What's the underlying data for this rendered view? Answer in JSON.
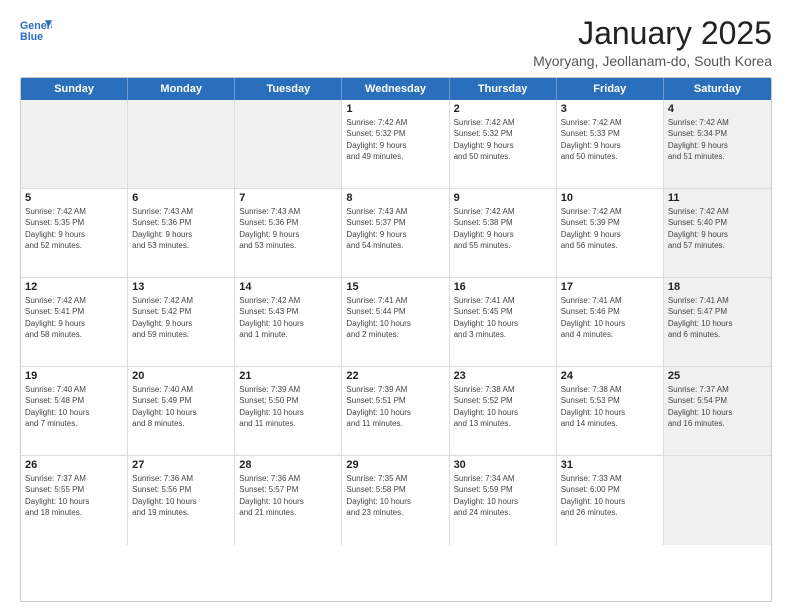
{
  "logo": {
    "line1": "General",
    "line2": "Blue"
  },
  "title": "January 2025",
  "location": "Myoryang, Jeollanam-do, South Korea",
  "header_days": [
    "Sunday",
    "Monday",
    "Tuesday",
    "Wednesday",
    "Thursday",
    "Friday",
    "Saturday"
  ],
  "weeks": [
    [
      {
        "day": "",
        "text": "",
        "shaded": true
      },
      {
        "day": "",
        "text": "",
        "shaded": true
      },
      {
        "day": "",
        "text": "",
        "shaded": true
      },
      {
        "day": "1",
        "text": "Sunrise: 7:42 AM\nSunset: 5:32 PM\nDaylight: 9 hours\nand 49 minutes."
      },
      {
        "day": "2",
        "text": "Sunrise: 7:42 AM\nSunset: 5:32 PM\nDaylight: 9 hours\nand 50 minutes."
      },
      {
        "day": "3",
        "text": "Sunrise: 7:42 AM\nSunset: 5:33 PM\nDaylight: 9 hours\nand 50 minutes."
      },
      {
        "day": "4",
        "text": "Sunrise: 7:42 AM\nSunset: 5:34 PM\nDaylight: 9 hours\nand 51 minutes.",
        "shaded": true
      }
    ],
    [
      {
        "day": "5",
        "text": "Sunrise: 7:42 AM\nSunset: 5:35 PM\nDaylight: 9 hours\nand 52 minutes."
      },
      {
        "day": "6",
        "text": "Sunrise: 7:43 AM\nSunset: 5:36 PM\nDaylight: 9 hours\nand 53 minutes."
      },
      {
        "day": "7",
        "text": "Sunrise: 7:43 AM\nSunset: 5:36 PM\nDaylight: 9 hours\nand 53 minutes."
      },
      {
        "day": "8",
        "text": "Sunrise: 7:43 AM\nSunset: 5:37 PM\nDaylight: 9 hours\nand 54 minutes."
      },
      {
        "day": "9",
        "text": "Sunrise: 7:42 AM\nSunset: 5:38 PM\nDaylight: 9 hours\nand 55 minutes."
      },
      {
        "day": "10",
        "text": "Sunrise: 7:42 AM\nSunset: 5:39 PM\nDaylight: 9 hours\nand 56 minutes."
      },
      {
        "day": "11",
        "text": "Sunrise: 7:42 AM\nSunset: 5:40 PM\nDaylight: 9 hours\nand 57 minutes.",
        "shaded": true
      }
    ],
    [
      {
        "day": "12",
        "text": "Sunrise: 7:42 AM\nSunset: 5:41 PM\nDaylight: 9 hours\nand 58 minutes."
      },
      {
        "day": "13",
        "text": "Sunrise: 7:42 AM\nSunset: 5:42 PM\nDaylight: 9 hours\nand 59 minutes."
      },
      {
        "day": "14",
        "text": "Sunrise: 7:42 AM\nSunset: 5:43 PM\nDaylight: 10 hours\nand 1 minute."
      },
      {
        "day": "15",
        "text": "Sunrise: 7:41 AM\nSunset: 5:44 PM\nDaylight: 10 hours\nand 2 minutes."
      },
      {
        "day": "16",
        "text": "Sunrise: 7:41 AM\nSunset: 5:45 PM\nDaylight: 10 hours\nand 3 minutes."
      },
      {
        "day": "17",
        "text": "Sunrise: 7:41 AM\nSunset: 5:46 PM\nDaylight: 10 hours\nand 4 minutes."
      },
      {
        "day": "18",
        "text": "Sunrise: 7:41 AM\nSunset: 5:47 PM\nDaylight: 10 hours\nand 6 minutes.",
        "shaded": true
      }
    ],
    [
      {
        "day": "19",
        "text": "Sunrise: 7:40 AM\nSunset: 5:48 PM\nDaylight: 10 hours\nand 7 minutes."
      },
      {
        "day": "20",
        "text": "Sunrise: 7:40 AM\nSunset: 5:49 PM\nDaylight: 10 hours\nand 8 minutes."
      },
      {
        "day": "21",
        "text": "Sunrise: 7:39 AM\nSunset: 5:50 PM\nDaylight: 10 hours\nand 11 minutes."
      },
      {
        "day": "22",
        "text": "Sunrise: 7:39 AM\nSunset: 5:51 PM\nDaylight: 10 hours\nand 11 minutes."
      },
      {
        "day": "23",
        "text": "Sunrise: 7:38 AM\nSunset: 5:52 PM\nDaylight: 10 hours\nand 13 minutes."
      },
      {
        "day": "24",
        "text": "Sunrise: 7:38 AM\nSunset: 5:53 PM\nDaylight: 10 hours\nand 14 minutes."
      },
      {
        "day": "25",
        "text": "Sunrise: 7:37 AM\nSunset: 5:54 PM\nDaylight: 10 hours\nand 16 minutes.",
        "shaded": true
      }
    ],
    [
      {
        "day": "26",
        "text": "Sunrise: 7:37 AM\nSunset: 5:55 PM\nDaylight: 10 hours\nand 18 minutes."
      },
      {
        "day": "27",
        "text": "Sunrise: 7:36 AM\nSunset: 5:56 PM\nDaylight: 10 hours\nand 19 minutes."
      },
      {
        "day": "28",
        "text": "Sunrise: 7:36 AM\nSunset: 5:57 PM\nDaylight: 10 hours\nand 21 minutes."
      },
      {
        "day": "29",
        "text": "Sunrise: 7:35 AM\nSunset: 5:58 PM\nDaylight: 10 hours\nand 23 minutes."
      },
      {
        "day": "30",
        "text": "Sunrise: 7:34 AM\nSunset: 5:59 PM\nDaylight: 10 hours\nand 24 minutes."
      },
      {
        "day": "31",
        "text": "Sunrise: 7:33 AM\nSunset: 6:00 PM\nDaylight: 10 hours\nand 26 minutes."
      },
      {
        "day": "",
        "text": "",
        "shaded": true
      }
    ]
  ]
}
